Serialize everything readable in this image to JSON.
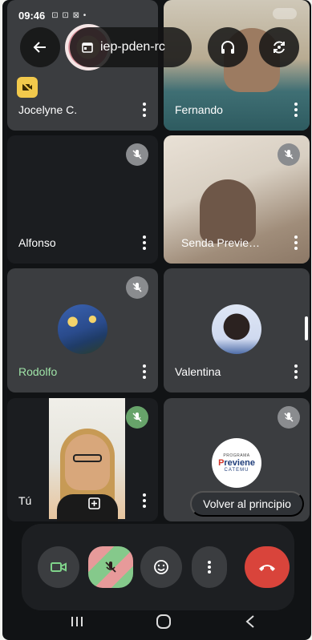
{
  "status_bar": {
    "time": "09:46",
    "icons": "⊡ ⊡ ⊠ •"
  },
  "top_bar": {
    "meeting_code": "iep-pden-rc"
  },
  "participants": [
    {
      "name": "Jocelyne C."
    },
    {
      "name": "Fernando"
    },
    {
      "name": "Alfonso"
    },
    {
      "name": "Senda Previe…"
    },
    {
      "name": "Rodolfo"
    },
    {
      "name": "Valentina"
    },
    {
      "name": "Tú"
    }
  ],
  "logo_tile": {
    "small": "PROGRAMA",
    "main_r": "P",
    "main": "reviene",
    "sub": "CATEMU"
  },
  "back_to_top_label": "Volver al principio",
  "colors": {
    "end_call": "#d9443b",
    "camera_off_badge": "#f2c94c",
    "speaking_name": "#9fe3a7"
  }
}
